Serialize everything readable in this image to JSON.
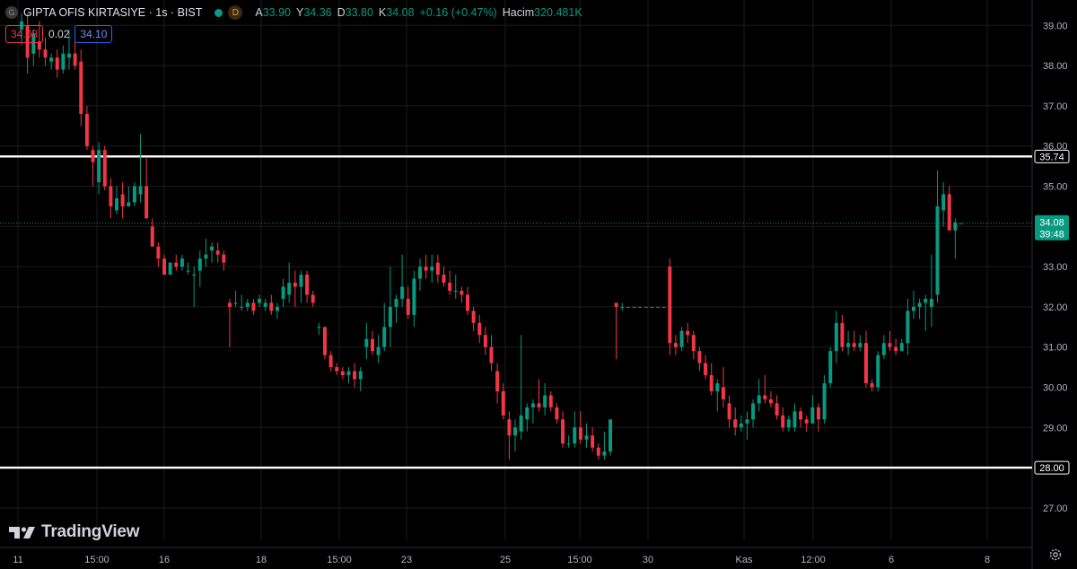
{
  "symbol": {
    "icon": "G",
    "title": "GIPTA OFIS KIRTASIYE · 1s · BIST",
    "market_badge": "D"
  },
  "ohlc": {
    "open_label": "A",
    "open": "33.90",
    "high_label": "Y",
    "high": "34.36",
    "low_label": "D",
    "low": "33.80",
    "close_label": "K",
    "close": "34.08",
    "change": "+0.16 (+0.47%)",
    "volume_label": "Hacim",
    "volume": "320.481K"
  },
  "quote": {
    "sell": "34.08",
    "spread": "0.02",
    "buy": "34.10"
  },
  "brand": "TradingView",
  "colors": {
    "background": "#000000",
    "grid": "#1c1c1c",
    "up": "#089981",
    "down": "#f23645",
    "axis_text": "#b2b5be",
    "hline": "#ffffff"
  },
  "icons": [
    "tradingview-logo-icon",
    "settings-gear-icon"
  ],
  "chart_data": {
    "type": "candlestick",
    "title": "",
    "y_ticks": [
      "39.00",
      "38.00",
      "37.00",
      "36.00",
      "35.00",
      "34.00",
      "33.00",
      "32.00",
      "31.00",
      "30.00",
      "29.00",
      "28.00",
      "27.00"
    ],
    "ylim": [
      26.55,
      39.25
    ],
    "x_ticks": [
      "11",
      "15:00",
      "16",
      "18",
      "15:00",
      "23",
      "25",
      "15:00",
      "30",
      "Kas",
      "12:00",
      "6",
      "8"
    ],
    "last_price": {
      "value": 34.08,
      "label": "34.08",
      "countdown": "39:48"
    },
    "horizontal_lines": [
      {
        "value": 35.74,
        "label": "35.74"
      },
      {
        "value": 28.0,
        "label": "28.00"
      }
    ],
    "candles": [
      [
        38.9,
        39.3,
        38.5,
        39.1
      ],
      [
        39.0,
        39.3,
        37.8,
        38.2
      ],
      [
        38.3,
        38.9,
        38.0,
        38.8
      ],
      [
        38.6,
        39.1,
        38.2,
        38.4
      ],
      [
        38.4,
        38.7,
        38.0,
        38.2
      ],
      [
        38.1,
        38.3,
        37.9,
        38.2
      ],
      [
        38.2,
        38.4,
        37.7,
        37.9
      ],
      [
        37.9,
        38.5,
        37.8,
        38.3
      ],
      [
        38.2,
        38.9,
        37.9,
        38.3
      ],
      [
        38.3,
        38.6,
        37.9,
        38.0
      ],
      [
        38.1,
        38.4,
        36.5,
        36.8
      ],
      [
        36.8,
        37.0,
        35.9,
        36.0
      ],
      [
        35.9,
        36.0,
        35.0,
        35.6
      ],
      [
        35.1,
        36.1,
        34.8,
        35.9
      ],
      [
        35.9,
        36.0,
        34.9,
        35.0
      ],
      [
        35.0,
        35.2,
        34.2,
        34.5
      ],
      [
        34.4,
        35.0,
        34.3,
        34.7
      ],
      [
        34.8,
        35.1,
        34.2,
        34.5
      ],
      [
        34.5,
        35.0,
        34.5,
        34.6
      ],
      [
        34.6,
        35.1,
        34.5,
        35.0
      ],
      [
        34.8,
        36.3,
        34.6,
        35.0
      ],
      [
        35.0,
        35.7,
        34.2,
        34.2
      ],
      [
        34.0,
        34.2,
        33.5,
        33.5
      ],
      [
        33.5,
        33.6,
        33.0,
        33.2
      ],
      [
        33.2,
        33.3,
        32.8,
        32.8
      ],
      [
        32.8,
        33.1,
        32.8,
        33.1
      ],
      [
        33.1,
        33.3,
        32.9,
        33.0
      ],
      [
        33.0,
        33.3,
        32.9,
        33.2
      ],
      [
        32.9,
        33.1,
        32.8,
        32.9
      ],
      [
        32.8,
        33.0,
        32.0,
        32.8
      ],
      [
        32.9,
        33.4,
        32.5,
        33.2
      ],
      [
        33.2,
        33.7,
        33.0,
        33.3
      ],
      [
        33.4,
        33.6,
        33.1,
        33.5
      ],
      [
        33.4,
        33.6,
        33.1,
        33.3
      ],
      [
        33.3,
        33.4,
        32.9,
        33.1
      ],
      [
        32.1,
        32.2,
        31.0,
        32.0
      ],
      [
        32.1,
        32.4,
        32.0,
        32.1
      ],
      [
        32.0,
        32.3,
        31.9,
        32.0
      ],
      [
        32.0,
        32.2,
        31.9,
        32.1
      ],
      [
        32.1,
        32.2,
        31.8,
        31.9
      ],
      [
        32.1,
        32.3,
        32.0,
        32.2
      ],
      [
        32.0,
        32.2,
        31.9,
        32.1
      ],
      [
        32.1,
        32.3,
        31.8,
        31.9
      ],
      [
        31.9,
        32.1,
        31.7,
        32.0
      ],
      [
        32.2,
        32.7,
        32.0,
        32.5
      ],
      [
        32.3,
        33.1,
        32.1,
        32.6
      ],
      [
        32.6,
        32.9,
        32.0,
        32.5
      ],
      [
        32.5,
        32.9,
        32.1,
        32.8
      ],
      [
        32.8,
        32.9,
        32.1,
        32.3
      ],
      [
        32.3,
        32.4,
        32.0,
        32.1
      ],
      [
        31.5,
        31.6,
        31.3,
        31.5
      ],
      [
        31.5,
        31.5,
        30.7,
        30.8
      ],
      [
        30.8,
        30.9,
        30.4,
        30.5
      ],
      [
        30.5,
        30.6,
        30.3,
        30.4
      ],
      [
        30.4,
        30.5,
        30.2,
        30.3
      ],
      [
        30.3,
        30.5,
        30.1,
        30.4
      ],
      [
        30.4,
        30.6,
        30.0,
        30.2
      ],
      [
        30.2,
        30.5,
        29.9,
        30.4
      ],
      [
        31.0,
        31.6,
        30.7,
        31.2
      ],
      [
        31.2,
        31.4,
        30.8,
        30.9
      ],
      [
        30.8,
        31.3,
        30.6,
        31.0
      ],
      [
        31.0,
        32.1,
        30.9,
        31.5
      ],
      [
        31.5,
        33.0,
        31.0,
        32.0
      ],
      [
        32.0,
        32.3,
        31.6,
        32.2
      ],
      [
        32.2,
        33.3,
        32.0,
        32.5
      ],
      [
        32.2,
        32.5,
        31.7,
        31.8
      ],
      [
        31.8,
        32.9,
        31.5,
        32.7
      ],
      [
        32.7,
        33.2,
        32.4,
        33.0
      ],
      [
        33.0,
        33.3,
        32.7,
        32.9
      ],
      [
        32.9,
        33.3,
        32.6,
        33.0
      ],
      [
        33.1,
        33.3,
        32.6,
        32.8
      ],
      [
        32.8,
        33.0,
        32.5,
        32.6
      ],
      [
        32.6,
        32.9,
        32.3,
        32.4
      ],
      [
        32.4,
        32.8,
        32.2,
        32.4
      ],
      [
        32.4,
        32.5,
        32.1,
        32.3
      ],
      [
        32.3,
        32.5,
        31.8,
        31.9
      ],
      [
        31.9,
        32.0,
        31.4,
        31.6
      ],
      [
        31.6,
        31.8,
        31.1,
        31.3
      ],
      [
        31.3,
        31.5,
        30.8,
        31.0
      ],
      [
        31.0,
        31.3,
        30.4,
        30.6
      ],
      [
        30.4,
        30.6,
        29.6,
        29.9
      ],
      [
        29.9,
        30.1,
        29.2,
        29.3
      ],
      [
        29.2,
        29.4,
        28.2,
        28.8
      ],
      [
        28.8,
        29.2,
        28.4,
        29.0
      ],
      [
        28.9,
        31.3,
        28.7,
        29.3
      ],
      [
        29.2,
        29.6,
        28.9,
        29.5
      ],
      [
        29.5,
        29.7,
        29.1,
        29.6
      ],
      [
        29.6,
        30.2,
        29.4,
        29.5
      ],
      [
        29.5,
        30.1,
        29.3,
        29.8
      ],
      [
        29.8,
        29.9,
        29.4,
        29.5
      ],
      [
        29.5,
        29.6,
        29.1,
        29.2
      ],
      [
        29.2,
        29.4,
        28.5,
        28.6
      ],
      [
        28.6,
        28.8,
        28.5,
        28.6
      ],
      [
        28.6,
        29.4,
        28.5,
        29.0
      ],
      [
        29.0,
        29.4,
        28.6,
        28.7
      ],
      [
        28.7,
        29.1,
        28.5,
        28.8
      ],
      [
        28.8,
        29.0,
        28.4,
        28.5
      ],
      [
        28.5,
        28.6,
        28.2,
        28.3
      ],
      [
        28.3,
        28.9,
        28.2,
        28.4
      ],
      [
        28.4,
        29.2,
        28.3,
        29.2
      ],
      [
        32.1,
        32.1,
        30.7,
        32.0
      ],
      [
        32.0,
        32.1,
        31.9,
        32.0
      ],
      [
        32.0,
        32.0,
        32.0,
        32.0
      ],
      [
        32.0,
        32.0,
        32.0,
        32.0
      ],
      [
        32.0,
        32.0,
        32.0,
        32.0
      ],
      [
        32.0,
        32.0,
        32.0,
        32.0
      ],
      [
        32.0,
        32.0,
        32.0,
        32.0
      ],
      [
        32.0,
        32.0,
        32.0,
        32.0
      ],
      [
        32.0,
        32.0,
        32.0,
        32.0
      ],
      [
        33.0,
        33.2,
        30.8,
        31.1
      ],
      [
        31.1,
        31.3,
        30.8,
        31.0
      ],
      [
        31.0,
        31.5,
        30.9,
        31.4
      ],
      [
        31.4,
        31.6,
        31.1,
        31.3
      ],
      [
        31.3,
        31.4,
        30.7,
        30.9
      ],
      [
        30.9,
        31.0,
        30.4,
        30.6
      ],
      [
        30.6,
        30.8,
        30.2,
        30.3
      ],
      [
        30.3,
        30.6,
        29.8,
        29.9
      ],
      [
        29.9,
        30.2,
        29.4,
        30.1
      ],
      [
        30.0,
        30.5,
        29.5,
        29.7
      ],
      [
        29.6,
        29.8,
        29.0,
        29.2
      ],
      [
        29.2,
        29.5,
        28.8,
        29.0
      ],
      [
        29.0,
        29.3,
        28.9,
        29.1
      ],
      [
        29.1,
        29.4,
        28.7,
        29.2
      ],
      [
        29.2,
        29.7,
        29.0,
        29.6
      ],
      [
        29.6,
        30.2,
        29.4,
        29.8
      ],
      [
        29.8,
        30.3,
        29.6,
        29.7
      ],
      [
        29.7,
        29.9,
        29.5,
        29.6
      ],
      [
        29.6,
        29.8,
        29.2,
        29.3
      ],
      [
        29.3,
        29.5,
        28.9,
        29.0
      ],
      [
        29.0,
        29.3,
        28.9,
        29.2
      ],
      [
        29.0,
        29.6,
        28.9,
        29.4
      ],
      [
        29.4,
        29.5,
        29.0,
        29.2
      ],
      [
        29.2,
        29.3,
        28.9,
        29.1
      ],
      [
        29.1,
        29.8,
        29.1,
        29.5
      ],
      [
        29.5,
        29.6,
        28.9,
        29.2
      ],
      [
        29.2,
        30.3,
        29.1,
        30.1
      ],
      [
        30.1,
        31.0,
        30.0,
        30.9
      ],
      [
        30.9,
        31.9,
        30.6,
        31.6
      ],
      [
        31.6,
        31.8,
        30.9,
        31.0
      ],
      [
        31.0,
        31.4,
        30.8,
        31.1
      ],
      [
        31.1,
        31.4,
        30.9,
        31.0
      ],
      [
        31.0,
        31.3,
        30.9,
        31.1
      ],
      [
        31.1,
        31.4,
        30.0,
        30.1
      ],
      [
        30.1,
        30.2,
        29.9,
        30.0
      ],
      [
        30.0,
        30.9,
        29.9,
        30.8
      ],
      [
        30.8,
        31.3,
        30.7,
        31.1
      ],
      [
        31.1,
        31.4,
        30.9,
        31.0
      ],
      [
        31.0,
        31.2,
        30.8,
        30.9
      ],
      [
        30.9,
        31.2,
        30.9,
        31.1
      ],
      [
        31.1,
        32.2,
        30.8,
        31.9
      ],
      [
        31.9,
        32.4,
        31.7,
        32.0
      ],
      [
        32.0,
        32.2,
        31.7,
        32.1
      ],
      [
        32.1,
        32.3,
        31.4,
        32.2
      ],
      [
        32.0,
        33.3,
        31.5,
        32.2
      ],
      [
        32.3,
        35.4,
        32.1,
        34.5
      ],
      [
        34.4,
        35.1,
        34.0,
        34.8
      ],
      [
        34.8,
        35.0,
        33.9,
        33.9
      ],
      [
        33.9,
        34.2,
        33.2,
        34.1
      ],
      [
        34.08,
        34.08,
        34.08,
        34.08
      ]
    ]
  }
}
